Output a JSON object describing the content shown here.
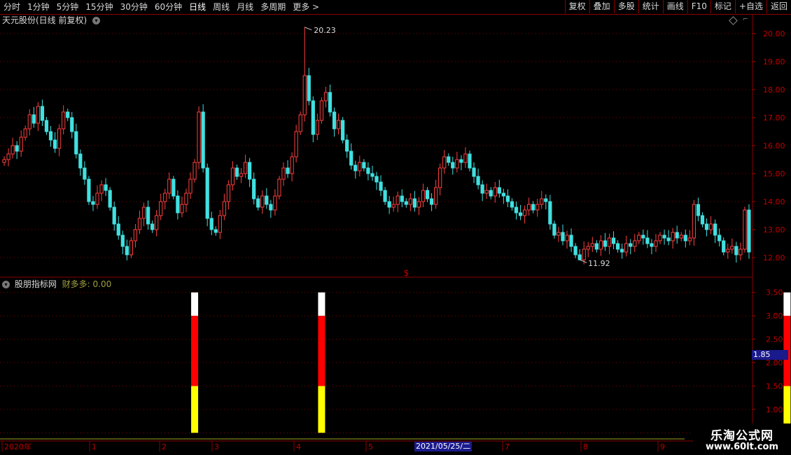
{
  "toolbar": {
    "periods": [
      "分时",
      "1分钟",
      "5分钟",
      "15分钟",
      "30分钟",
      "60分钟",
      "日线",
      "周线",
      "月线",
      "多周期",
      "更多 >"
    ],
    "active_period": "日线",
    "right_buttons": [
      "复权",
      "叠加",
      "多股",
      "统计",
      "画线",
      "F10",
      "标记",
      "+自选",
      "返回"
    ]
  },
  "main_chart": {
    "title": "天元股份(日线 前复权)",
    "high_label": "20.23",
    "low_label": "11.92",
    "marker_symbol": "$"
  },
  "sub_chart": {
    "title": "股朋指标网",
    "indicator": "财多多: 0.00",
    "highlight_value": "1.85"
  },
  "time_axis": {
    "labels": [
      "2020年",
      "1",
      "2",
      "3",
      "4",
      "5",
      "7",
      "8",
      "9"
    ],
    "highlight_date": "2021/05/25/二"
  },
  "watermark": {
    "title": "乐淘公式网",
    "url": "www.60lt.com"
  },
  "colors": {
    "up": "#ff4040",
    "down": "#40e0e0",
    "axis": "#c00000",
    "grid": "#8a0000",
    "bar_red": "#ff0000",
    "bar_yellow": "#ffff00",
    "bar_white": "#ffffff"
  },
  "chart_data": [
    {
      "type": "candlestick",
      "y_ticks": [
        12.0,
        13.0,
        14.0,
        15.0,
        16.0,
        17.0,
        18.0,
        19.0,
        20.0
      ],
      "ylim": [
        11.5,
        20.5
      ],
      "annotations": [
        {
          "label": "20.23",
          "value": 20.23
        },
        {
          "label": "11.92",
          "value": 11.92
        }
      ],
      "close_series": [
        15.5,
        15.7,
        16.0,
        15.8,
        16.3,
        16.6,
        17.1,
        16.8,
        17.4,
        16.9,
        16.5,
        16.2,
        15.9,
        16.6,
        17.2,
        17.0,
        16.5,
        15.7,
        15.2,
        14.8,
        14.0,
        13.9,
        14.3,
        14.6,
        14.4,
        13.8,
        13.2,
        12.8,
        12.4,
        12.1,
        12.6,
        13.0,
        13.4,
        13.8,
        13.2,
        13.0,
        13.5,
        14.0,
        14.3,
        14.8,
        14.2,
        13.6,
        13.9,
        14.3,
        14.8,
        15.4,
        17.2,
        15.2,
        13.4,
        13.0,
        12.9,
        13.5,
        14.0,
        14.6,
        15.2,
        14.9,
        15.0,
        15.4,
        14.8,
        14.1,
        13.8,
        14.2,
        13.9,
        13.7,
        14.2,
        14.8,
        15.2,
        15.0,
        15.6,
        16.5,
        17.1,
        18.5,
        17.6,
        16.4,
        16.9,
        17.6,
        17.9,
        17.2,
        16.6,
        16.9,
        16.2,
        15.8,
        15.3,
        15.1,
        15.4,
        15.2,
        15.0,
        14.9,
        14.7,
        14.4,
        14.0,
        13.8,
        13.9,
        14.2,
        14.0,
        13.9,
        14.1,
        13.8,
        14.0,
        14.4,
        14.1,
        13.9,
        14.5,
        15.2,
        15.6,
        15.4,
        15.2,
        15.5,
        15.4,
        15.7,
        15.2,
        14.9,
        14.6,
        14.3,
        14.4,
        14.2,
        14.5,
        14.3,
        14.2,
        14.0,
        13.8,
        13.6,
        13.5,
        13.7,
        13.9,
        13.7,
        13.9,
        14.1,
        14.0,
        13.2,
        12.8,
        12.9,
        12.6,
        12.8,
        12.4,
        12.1,
        11.92,
        12.3,
        12.4,
        12.5,
        12.3,
        12.6,
        12.4,
        12.7,
        12.5,
        12.3,
        12.2,
        12.5,
        12.4,
        12.6,
        12.8,
        12.7,
        12.5,
        12.4,
        12.6,
        12.8,
        12.7,
        12.6,
        12.9,
        12.7,
        12.8,
        12.6,
        12.7,
        13.9,
        13.5,
        13.2,
        13.0,
        13.2,
        12.8,
        12.6,
        12.2,
        12.3,
        12.4,
        12.1,
        12.3,
        13.7,
        12.2
      ],
      "dollar_marker_index": 95
    },
    {
      "type": "bar",
      "title": "财多多",
      "y_ticks": [
        0.5,
        1.0,
        1.5,
        2.0,
        2.5,
        3.0,
        3.5
      ],
      "ylim": [
        0.4,
        3.75
      ],
      "signals": [
        {
          "index": 45,
          "segments": [
            {
              "color": "yellow",
              "from": 0.5,
              "to": 1.5
            },
            {
              "color": "red",
              "from": 1.5,
              "to": 3.0
            },
            {
              "color": "white",
              "from": 3.0,
              "to": 3.5
            }
          ]
        },
        {
          "index": 75,
          "segments": [
            {
              "color": "yellow",
              "from": 0.5,
              "to": 1.5
            },
            {
              "color": "red",
              "from": 1.5,
              "to": 3.0
            },
            {
              "color": "white",
              "from": 3.0,
              "to": 3.5
            }
          ]
        },
        {
          "index": 185,
          "segments": [
            {
              "color": "yellow",
              "from": 0.5,
              "to": 1.5
            },
            {
              "color": "red",
              "from": 1.5,
              "to": 3.0
            },
            {
              "color": "white",
              "from": 3.0,
              "to": 3.5
            }
          ]
        }
      ]
    }
  ]
}
